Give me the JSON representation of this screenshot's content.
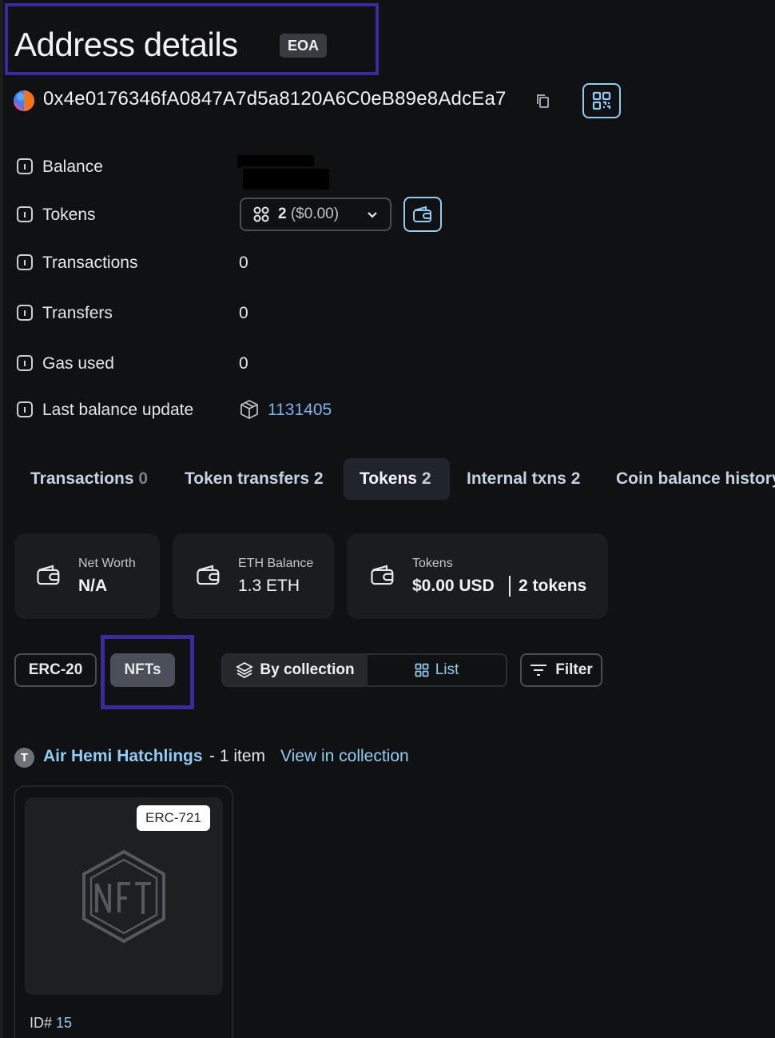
{
  "header": {
    "title": "Address details",
    "badge": "EOA"
  },
  "address": {
    "hash": "0x4e0176346fA0847A7d5a8120A6C0eB89e8AdcEa7"
  },
  "details": {
    "balance_label": "Balance",
    "tokens_label": "Tokens",
    "tokens_select": {
      "count": "2",
      "value": "($0.00)"
    },
    "transactions_label": "Transactions",
    "transactions_value": "0",
    "transfers_label": "Transfers",
    "transfers_value": "0",
    "gas_label": "Gas used",
    "gas_value": "0",
    "last_update_label": "Last balance update",
    "last_update_block": "1131405"
  },
  "tabs": [
    {
      "label": "Transactions",
      "count": "0"
    },
    {
      "label": "Token transfers",
      "count": "2"
    },
    {
      "label": "Tokens",
      "count": "2"
    },
    {
      "label": "Internal txns",
      "count": "2"
    },
    {
      "label": "Coin balance history",
      "count": ""
    }
  ],
  "cards": [
    {
      "label": "Net Worth",
      "value": "N/A"
    },
    {
      "label": "ETH Balance",
      "value": "1.3 ETH"
    },
    {
      "label": "Tokens",
      "value": "$0.00 USD",
      "extra": "2 tokens"
    }
  ],
  "filters": {
    "erc20": "ERC-20",
    "nfts": "NFTs",
    "by_collection": "By collection",
    "list": "List",
    "filter": "Filter"
  },
  "collection": {
    "avatar_letter": "T",
    "name": "Air Hemi Hatchlings",
    "count": "- 1 item",
    "link": "View in collection"
  },
  "nft": {
    "type": "ERC-721",
    "id_label": "ID#",
    "id_value": "15"
  },
  "colors": {
    "accent": "#90cdf4",
    "highlight_outline": "#3b2a9e",
    "background": "#101112"
  }
}
